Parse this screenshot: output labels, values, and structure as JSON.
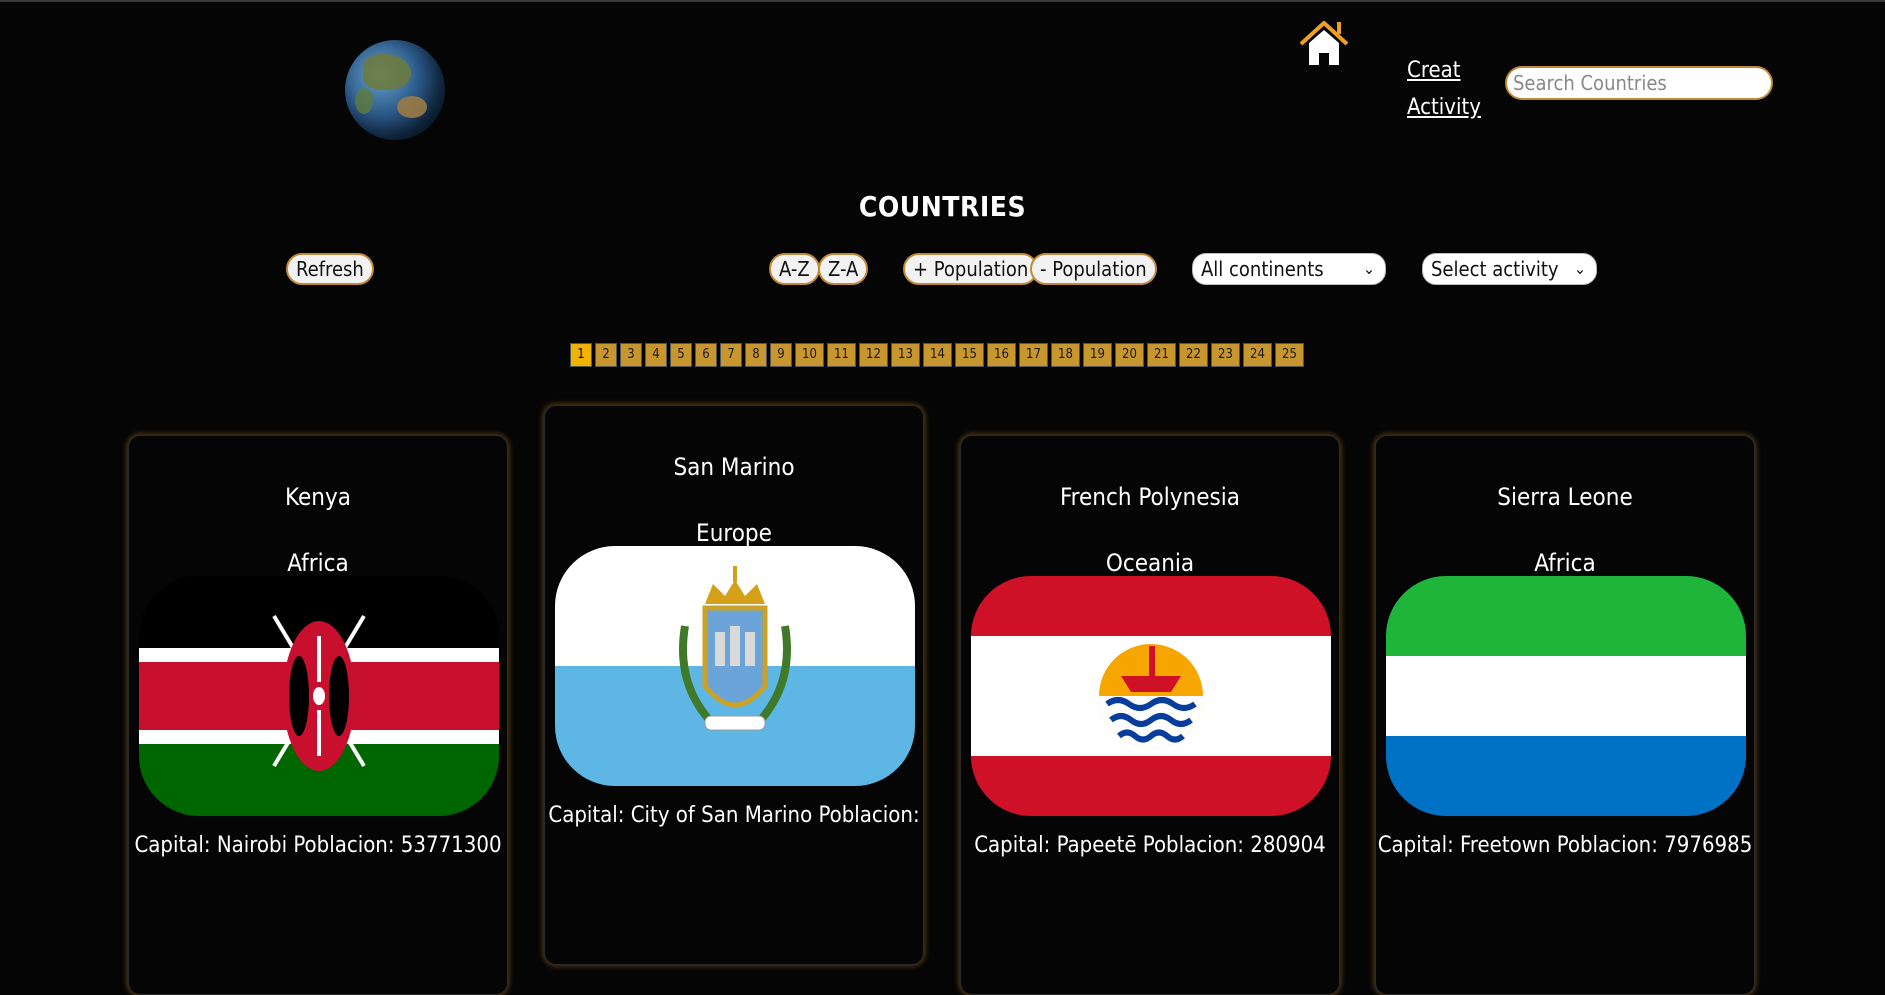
{
  "header": {
    "logo_icon": "globe-icon",
    "home_icon": "home-icon",
    "create_link": "Creat Activity",
    "search_placeholder": "Search Countries"
  },
  "page_title": "COUNTRIES",
  "controls": {
    "refresh": "Refresh",
    "sort_az": "A-Z",
    "sort_za": "Z-A",
    "pop_asc": "+ Population",
    "pop_desc": "- Population",
    "continent_select": "All continents",
    "activity_select": "Select activity"
  },
  "pagination": {
    "pages": [
      "1",
      "2",
      "3",
      "4",
      "5",
      "6",
      "7",
      "8",
      "9",
      "10",
      "11",
      "12",
      "13",
      "14",
      "15",
      "16",
      "17",
      "18",
      "19",
      "20",
      "21",
      "22",
      "23",
      "24",
      "25"
    ],
    "current": "1"
  },
  "cards": [
    {
      "name": "Kenya",
      "continent": "Africa",
      "info": "Capital: Nairobi Poblacion: 53771300",
      "flag": "kenya-flag"
    },
    {
      "name": "San Marino",
      "continent": "Europe",
      "info": "Capital: City of San Marino Poblacion:",
      "flag": "san-marino-flag"
    },
    {
      "name": "French Polynesia",
      "continent": "Oceania",
      "info": "Capital: Papeetē Poblacion: 280904",
      "flag": "french-polynesia-flag"
    },
    {
      "name": "Sierra Leone",
      "continent": "Africa",
      "info": "Capital: Freetown Poblacion: 7976985",
      "flag": "sierra-leone-flag"
    }
  ],
  "colors": {
    "background": "#050505",
    "accent": "#c08a3a",
    "page_active": "#f0b400",
    "page_inactive": "#c8962f"
  }
}
